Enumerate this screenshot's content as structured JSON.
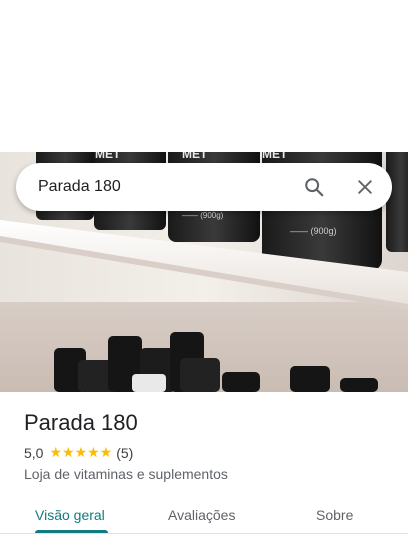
{
  "search": {
    "value": "Parada 180",
    "search_icon": "search-icon",
    "close_icon": "close-icon"
  },
  "place": {
    "name": "Parada 180",
    "rating": "5,0",
    "stars": "★★★★★",
    "review_count": "(5)",
    "category": "Loja de vitaminas e suplementos"
  },
  "tabs": [
    {
      "label": "Visão geral",
      "active": true
    },
    {
      "label": "Avaliações",
      "active": false
    },
    {
      "label": "Sobre",
      "active": false
    }
  ],
  "photo": {
    "jar_label_1": "...%3L (900g)",
    "jar_label_2": "...%3L (900g)",
    "brand_fragment": "MET"
  },
  "colors": {
    "accent": "#137a7f",
    "star": "#fbbc04"
  }
}
